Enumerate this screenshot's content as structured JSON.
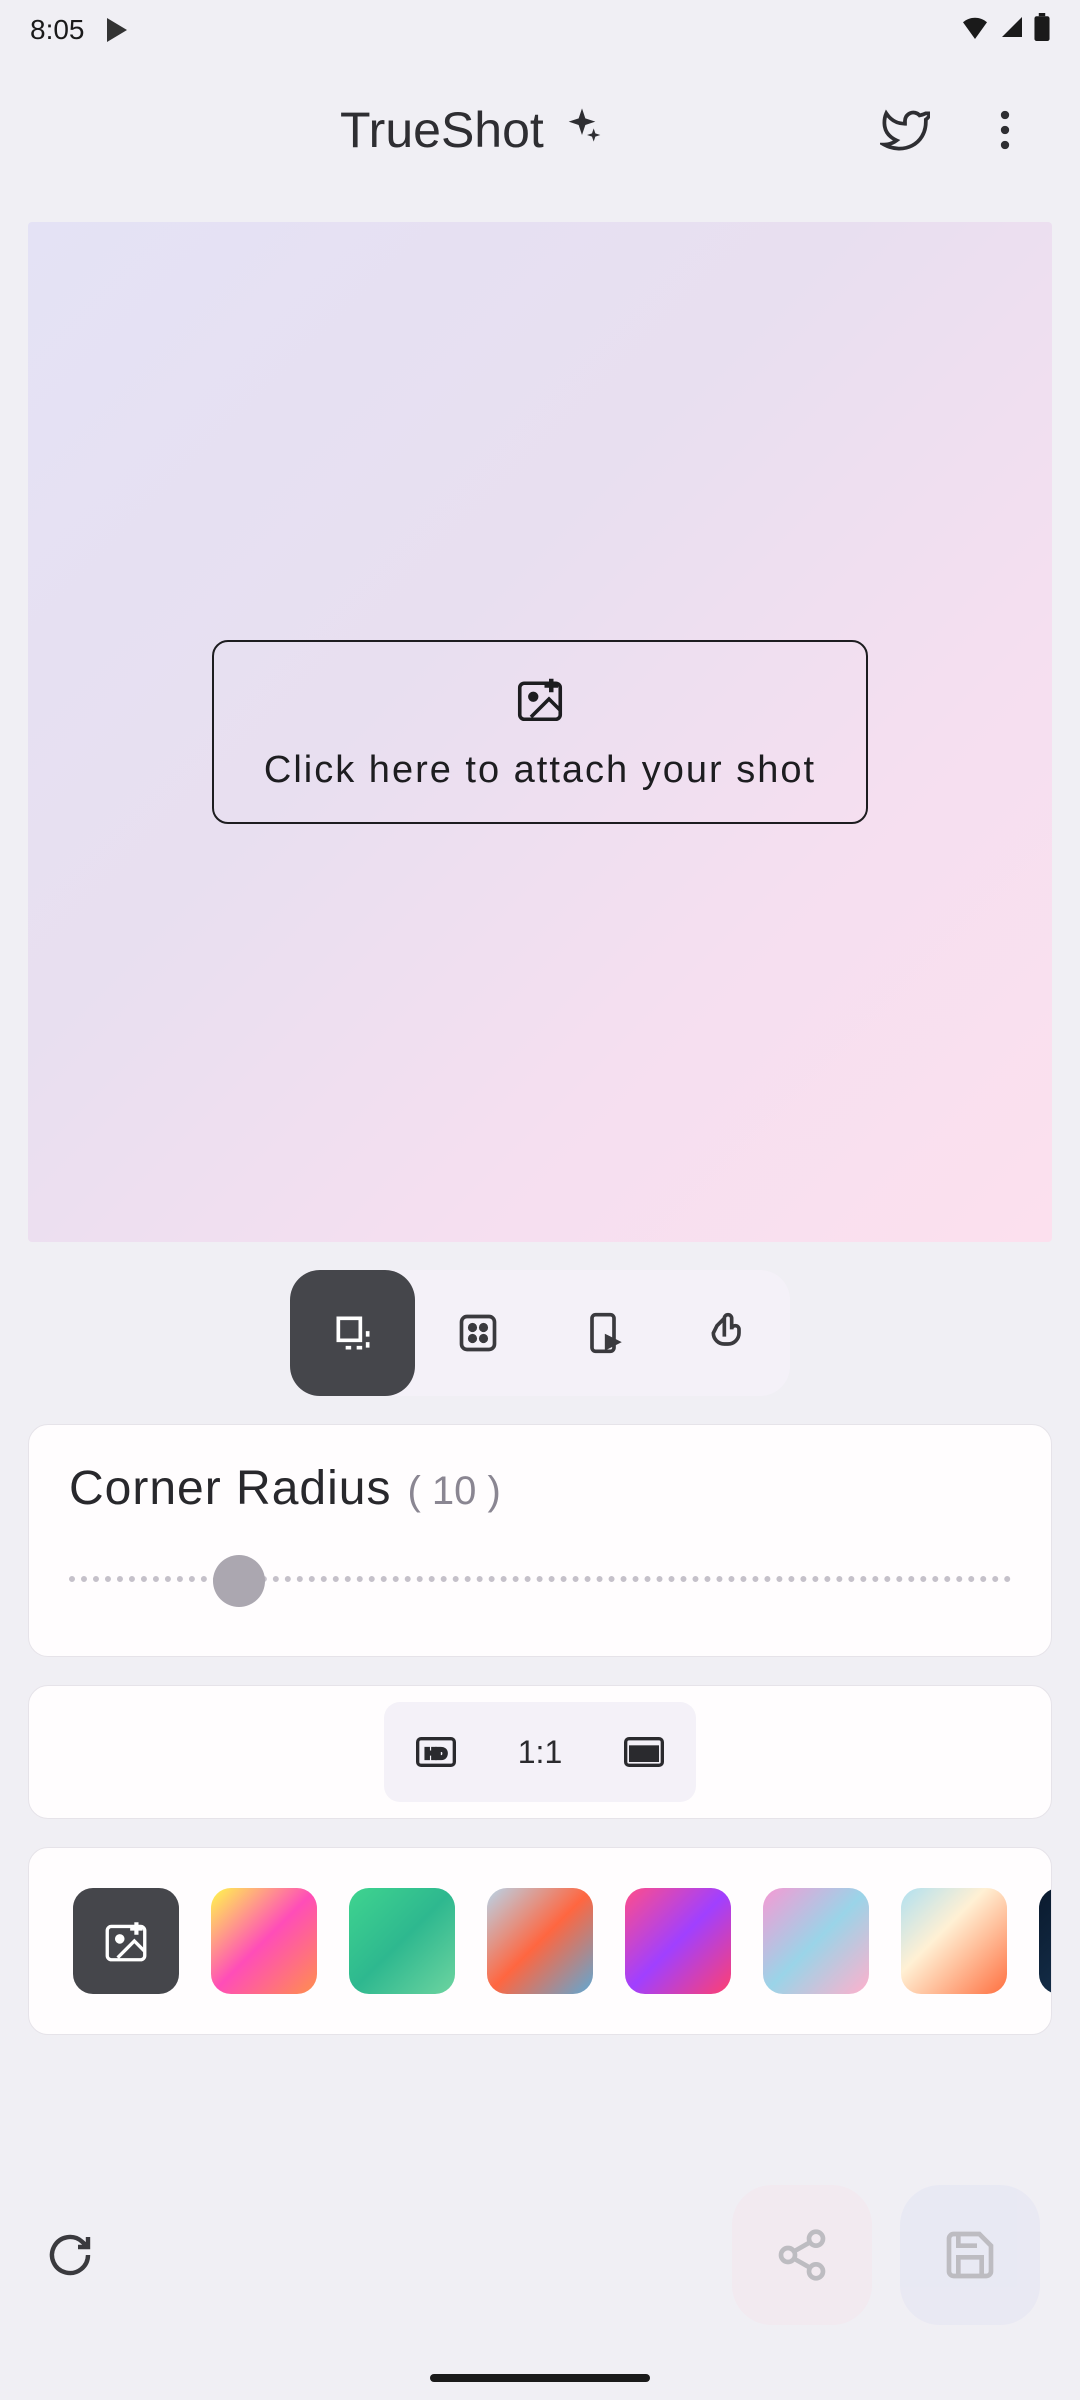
{
  "status": {
    "time": "8:05",
    "icons": [
      "wifi",
      "signal",
      "battery"
    ]
  },
  "header": {
    "title": "TrueShot",
    "sparkle_name": "sparkle-icon",
    "twitter_name": "twitter-icon",
    "more_name": "more-icon"
  },
  "canvas": {
    "attach_label": "Click here to attach your shot",
    "attach_icon_name": "add-image-icon"
  },
  "tool_tabs": {
    "items": [
      {
        "name": "frame-tool-tab",
        "icon": "frame-icon",
        "active": true
      },
      {
        "name": "grid-tool-tab",
        "icon": "dice-icon",
        "active": false
      },
      {
        "name": "device-tool-tab",
        "icon": "phone-play-icon",
        "active": false
      },
      {
        "name": "touch-tool-tab",
        "icon": "pointer-icon",
        "active": false
      }
    ]
  },
  "corner_radius": {
    "label": "Corner Radius",
    "value": "( 10 )",
    "slider_value": 10,
    "slider_min": 0,
    "slider_max": 50
  },
  "aspect": {
    "options": [
      {
        "name": "aspect-hd",
        "icon": "hd-icon",
        "label": ""
      },
      {
        "name": "aspect-1-1",
        "icon": "",
        "label": "1:1"
      },
      {
        "name": "aspect-wide",
        "icon": "wide-icon",
        "label": ""
      }
    ]
  },
  "backgrounds": {
    "add_icon_name": "add-image-icon",
    "swatches": [
      {
        "name": "bg-swatch-1",
        "gradient": "linear-gradient(135deg,#fff94d 0%,#ff4db8 50%,#ff8f4d 100%)"
      },
      {
        "name": "bg-swatch-2",
        "gradient": "linear-gradient(135deg,#3fd48f 0%,#2eb88f 50%,#6dd4a0 100%)"
      },
      {
        "name": "bg-swatch-3",
        "gradient": "linear-gradient(135deg,#b8d4e8 0%,#ff6640 50%,#5fa8d4 100%)"
      },
      {
        "name": "bg-swatch-4",
        "gradient": "linear-gradient(135deg,#ff4d8a 0%,#a040ff 50%,#ff4070 100%)"
      },
      {
        "name": "bg-swatch-5",
        "gradient": "linear-gradient(135deg,#f59ad4 0%,#9ad4e8 50%,#ffb0cc 100%)"
      },
      {
        "name": "bg-swatch-6",
        "gradient": "linear-gradient(135deg,#b0e0f0 0%,#fff0d4 40%,#ff7040 100%)"
      },
      {
        "name": "bg-swatch-7",
        "gradient": "linear-gradient(135deg,#0a1a2e 0%,#1a3a5a 100%)"
      }
    ]
  },
  "bottom": {
    "refresh_name": "refresh-icon",
    "share_name": "share-icon",
    "save_name": "save-icon"
  }
}
